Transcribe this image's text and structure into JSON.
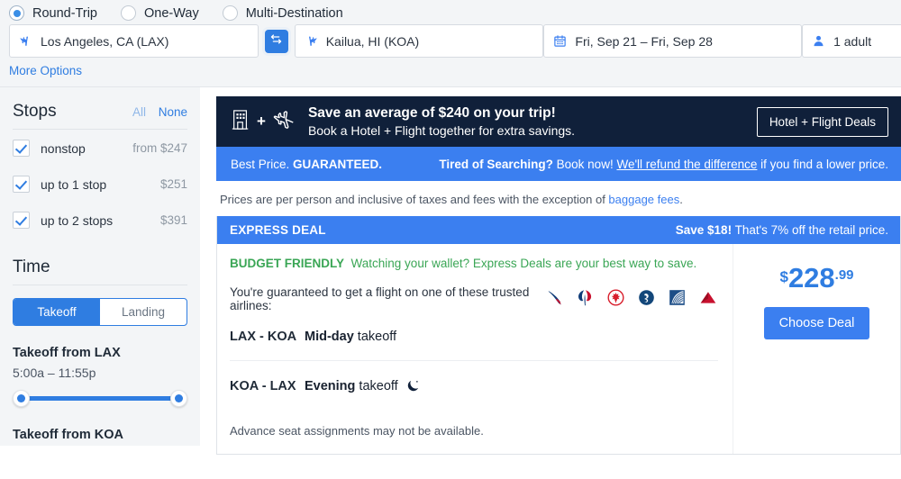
{
  "search": {
    "trip_types": [
      {
        "label": "Round-Trip",
        "selected": true
      },
      {
        "label": "One-Way",
        "selected": false
      },
      {
        "label": "Multi-Destination",
        "selected": false
      }
    ],
    "origin": "Los Angeles, CA (LAX)",
    "destination": "Kailua, HI (KOA)",
    "dates": "Fri, Sep 21 – Fri, Sep 28",
    "passengers": "1 adult",
    "swap_icon": "swap-horizontal-icon",
    "origin_icon": "airplane-depart-icon",
    "destination_icon": "airplane-arrive-icon",
    "date_icon": "calendar-icon",
    "passenger_icon": "person-icon",
    "more_options": "More Options"
  },
  "sidebar": {
    "stops": {
      "title": "Stops",
      "all_label": "All",
      "none_label": "None",
      "options": [
        {
          "label": "nonstop",
          "price": "from $247",
          "checked": true
        },
        {
          "label": "up to 1 stop",
          "price": "$251",
          "checked": true
        },
        {
          "label": "up to 2 stops",
          "price": "$391",
          "checked": true
        }
      ]
    },
    "time": {
      "title": "Time",
      "toggle": {
        "on": "Takeoff",
        "off": "Landing"
      },
      "sliders": [
        {
          "title": "Takeoff from LAX",
          "range": "5:00a  –  11:55p"
        },
        {
          "title": "Takeoff from KOA",
          "range": ""
        }
      ]
    }
  },
  "promo": {
    "hotel_icon": "hotel-building-icon",
    "plus": "+",
    "flight_icon": "airplane-outline-icon",
    "headline": "Save an average of $240 on your trip!",
    "subline": "Book a Hotel + Flight together for extra savings.",
    "button": "Hotel + Flight Deals"
  },
  "guarantee": {
    "left_plain": "Best Price.",
    "left_bold": "GUARANTEED.",
    "right_bold": "Tired of Searching?",
    "right_plain1": "Book now!",
    "right_link": "We'll refund the difference",
    "right_plain2": "if you find a lower price."
  },
  "prices_note": {
    "text1": "Prices are per person and inclusive of taxes and fees with the exception of ",
    "link": "baggage fees",
    "text2": "."
  },
  "deal": {
    "header_title": "EXPRESS DEAL",
    "save_bold": "Save $18!",
    "save_rest": " That's 7% off the retail price.",
    "budget_bold": "BUDGET FRIENDLY",
    "budget_rest": "Watching your wallet? Express Deals are your best way to save.",
    "trusted_text": "You're guaranteed to get a flight on one of these trusted airlines:",
    "airlines": [
      {
        "name": "alaska-airlines-logo-icon",
        "color": "#c8102e"
      },
      {
        "name": "american-airlines-logo-icon",
        "color": "#0f3c78"
      },
      {
        "name": "air-canada-logo-icon",
        "color": "#d81e2c"
      },
      {
        "name": "frontier-airlines-logo-icon",
        "color": "#13477a"
      },
      {
        "name": "united-airlines-logo-icon",
        "color": "#1c4d87"
      },
      {
        "name": "delta-airlines-logo-icon",
        "color": "#c8102e"
      }
    ],
    "legs": [
      {
        "route": "LAX - KOA",
        "time_bold": "Mid-day",
        "time_rest": " takeoff",
        "icon": null
      },
      {
        "route": "KOA - LAX",
        "time_bold": "Evening",
        "time_rest": " takeoff",
        "icon": "moon-icon"
      }
    ],
    "advance_note": "Advance seat assignments may not be available.",
    "price_currency": "$",
    "price_dollars": "228",
    "price_cents": ".99",
    "choose_label": "Choose Deal"
  },
  "colors": {
    "accent_blue": "#3b7ff0",
    "link_blue": "#2f7de1",
    "dark_navy": "#10203a",
    "budget_green": "#3aa655",
    "page_bg": "#f3f5f7"
  }
}
